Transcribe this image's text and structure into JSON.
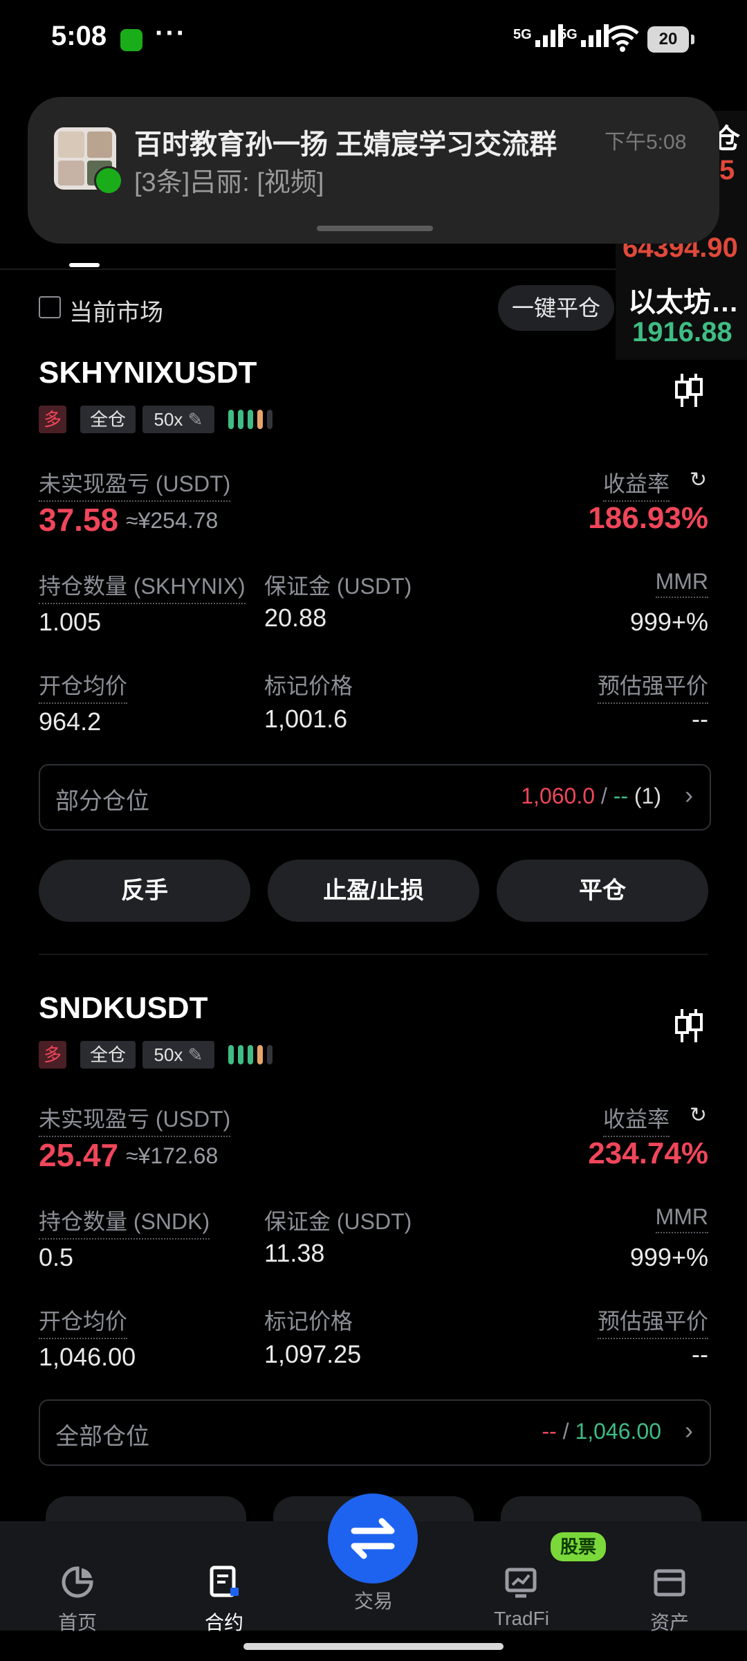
{
  "status_bar": {
    "time": "5:08",
    "signal1": "5G",
    "signal2": "5G",
    "battery": "20"
  },
  "notification": {
    "title": "百时教育孙一扬 王婧宸学习交流群",
    "time": "下午5:08",
    "message": "[3条]吕丽: [视频]"
  },
  "ticker": {
    "item1_name": "仓",
    "item1_value": "5",
    "item2_value": "64394.90",
    "item3_name": "以太坊…",
    "item3_value": "1916.88"
  },
  "filters": {
    "current_market": "当前市场",
    "one_click_close": "一键平仓"
  },
  "positions": [
    {
      "symbol": "SKHYNIXUSDT",
      "side": "多",
      "margin_mode": "全仓",
      "leverage": "50x",
      "unrealized_label": "未实现盈亏 (USDT)",
      "unrealized_value": "37.58",
      "unrealized_cny": "≈¥254.78",
      "roe_label": "收益率",
      "roe_value": "186.93%",
      "qty_label": "持仓数量 (SKHYNIX)",
      "qty_value": "1.005",
      "margin_label": "保证金 (USDT)",
      "margin_value": "20.88",
      "mmr_label": "MMR",
      "mmr_value": "999+%",
      "entry_label": "开仓均价",
      "entry_value": "964.2",
      "mark_label": "标记价格",
      "mark_value": "1,001.6",
      "liq_label": "预估强平价",
      "liq_value": "--",
      "partial_label": "部分仓位",
      "partial_tp": "1,060.0",
      "partial_sep": " / ",
      "partial_sl": "--",
      "partial_count": " (1)",
      "btn_reverse": "反手",
      "btn_tpsl": "止盈/止损",
      "btn_close": "平仓"
    },
    {
      "symbol": "SNDKUSDT",
      "side": "多",
      "margin_mode": "全仓",
      "leverage": "50x",
      "unrealized_label": "未实现盈亏 (USDT)",
      "unrealized_value": "25.47",
      "unrealized_cny": "≈¥172.68",
      "roe_label": "收益率",
      "roe_value": "234.74%",
      "qty_label": "持仓数量 (SNDK)",
      "qty_value": "0.5",
      "margin_label": "保证金 (USDT)",
      "margin_value": "11.38",
      "mmr_label": "MMR",
      "mmr_value": "999+%",
      "entry_label": "开仓均价",
      "entry_value": "1,046.00",
      "mark_label": "标记价格",
      "mark_value": "1,097.25",
      "liq_label": "预估强平价",
      "liq_value": "--",
      "partial_label": "全部仓位",
      "partial_tp": "--",
      "partial_sep": " / ",
      "partial_sl": "1,046.00"
    }
  ],
  "bottom_nav": {
    "home": "首页",
    "contract": "合约",
    "trade": "交易",
    "tradfi": "TradFi",
    "tradfi_badge": "股票",
    "assets": "资产"
  },
  "colors": {
    "up": "#f0465a",
    "down": "#3fbd84",
    "accent": "#1e63f0",
    "background": "#000000"
  }
}
